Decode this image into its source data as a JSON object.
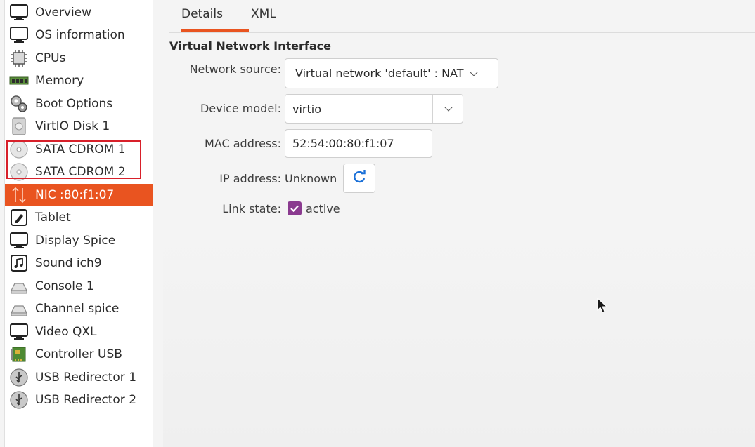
{
  "sidebar": {
    "items": [
      {
        "label": "Overview",
        "icon": "monitor-icon"
      },
      {
        "label": "OS information",
        "icon": "monitor-icon"
      },
      {
        "label": "CPUs",
        "icon": "cpu-icon"
      },
      {
        "label": "Memory",
        "icon": "memory-icon"
      },
      {
        "label": "Boot Options",
        "icon": "gears-icon"
      },
      {
        "label": "VirtIO Disk 1",
        "icon": "disk-icon"
      },
      {
        "label": "SATA CDROM 1",
        "icon": "cdrom-icon"
      },
      {
        "label": "SATA CDROM 2",
        "icon": "cdrom-icon"
      },
      {
        "label": "NIC :80:f1:07",
        "icon": "network-icon",
        "selected": true
      },
      {
        "label": "Tablet",
        "icon": "tablet-icon"
      },
      {
        "label": "Display Spice",
        "icon": "monitor-icon"
      },
      {
        "label": "Sound ich9",
        "icon": "sound-icon"
      },
      {
        "label": "Console 1",
        "icon": "serial-icon"
      },
      {
        "label": "Channel spice",
        "icon": "serial-icon"
      },
      {
        "label": "Video QXL",
        "icon": "monitor-icon"
      },
      {
        "label": "Controller USB",
        "icon": "controller-icon"
      },
      {
        "label": "USB Redirector 1",
        "icon": "usb-icon"
      },
      {
        "label": "USB Redirector 2",
        "icon": "usb-icon"
      }
    ]
  },
  "tabs": {
    "details": "Details",
    "xml": "XML"
  },
  "section_title": "Virtual Network Interface",
  "form": {
    "network_source_label": "Network source:",
    "network_source_value": "Virtual network 'default' : NAT",
    "device_model_label": "Device model:",
    "device_model_value": "virtio",
    "mac_label": "MAC address:",
    "mac_value": "52:54:00:80:f1:07",
    "ip_label": "IP address:",
    "ip_value": "Unknown",
    "link_state_label": "Link state:",
    "link_state_value": "active",
    "link_state_checked": true
  },
  "colors": {
    "accent": "#e95420",
    "checkbox": "#8a3a8f",
    "highlight_box": "#d8202a",
    "refresh": "#1c71d8"
  }
}
